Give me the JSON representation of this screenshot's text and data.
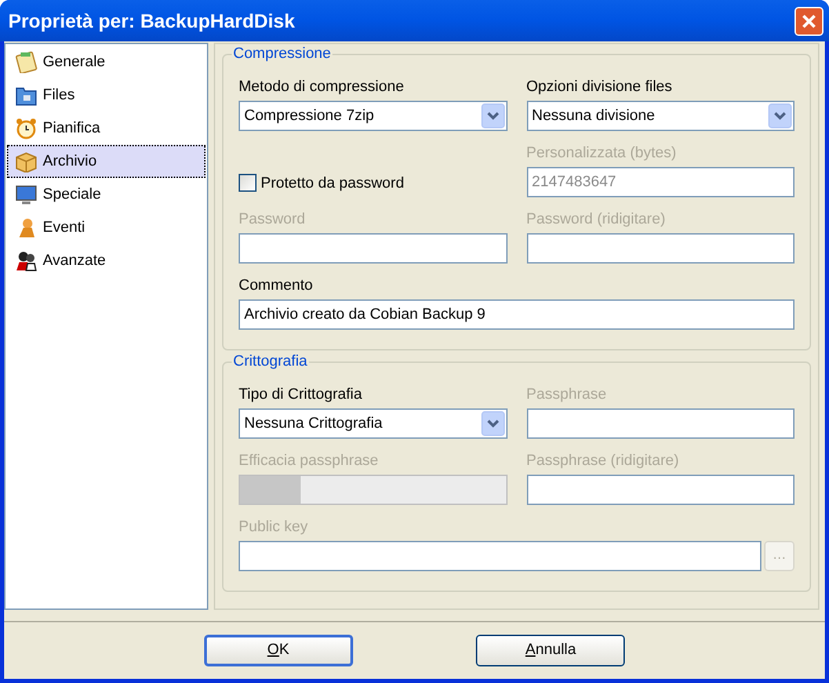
{
  "window": {
    "title": "Proprietà per: BackupHardDisk"
  },
  "sidebar": {
    "items": [
      {
        "label": "Generale",
        "selected": false
      },
      {
        "label": "Files",
        "selected": false
      },
      {
        "label": "Pianifica",
        "selected": false
      },
      {
        "label": "Archivio",
        "selected": true
      },
      {
        "label": "Speciale",
        "selected": false
      },
      {
        "label": "Eventi",
        "selected": false
      },
      {
        "label": "Avanzate",
        "selected": false
      }
    ]
  },
  "groups": [
    {
      "title": "Compressione",
      "rows": [
        [
          {
            "kind": "select",
            "label": "Metodo di compressione",
            "value": "Compressione 7zip",
            "disabled": false
          },
          {
            "kind": "select",
            "label": "Opzioni divisione files",
            "value": "Nessuna divisione",
            "disabled": false
          }
        ],
        [
          {
            "kind": "checkbox",
            "label": "Protetto da password",
            "checked": false
          },
          {
            "kind": "text",
            "label": "Personalizzata (bytes)",
            "value": "2147483647",
            "disabled": true
          }
        ],
        [
          {
            "kind": "text",
            "label": "Password",
            "disabled": true
          },
          {
            "kind": "text",
            "label": "Password (ridigitare)",
            "disabled": true
          }
        ],
        [
          {
            "kind": "wide",
            "label": "Commento",
            "value": "Archivio creato da Cobian Backup 9",
            "disabled": false
          }
        ]
      ]
    },
    {
      "title": "Crittografia",
      "rows": [
        [
          {
            "kind": "select",
            "label": "Tipo di Crittografia",
            "value": "Nessuna Crittografia",
            "disabled": false
          },
          {
            "kind": "text",
            "label": "Passphrase",
            "disabled": true
          }
        ],
        [
          {
            "kind": "meter",
            "label": "Efficacia passphrase",
            "level": 0.23,
            "disabled": true
          },
          {
            "kind": "text",
            "label": "Passphrase (ridigitare)",
            "disabled": true
          }
        ],
        [
          {
            "kind": "browse",
            "label": "Public key",
            "button": "…",
            "disabled": true
          }
        ]
      ]
    }
  ],
  "buttons": [
    {
      "label": "OK",
      "default": true
    },
    {
      "label": "Annulla",
      "default": false
    }
  ]
}
